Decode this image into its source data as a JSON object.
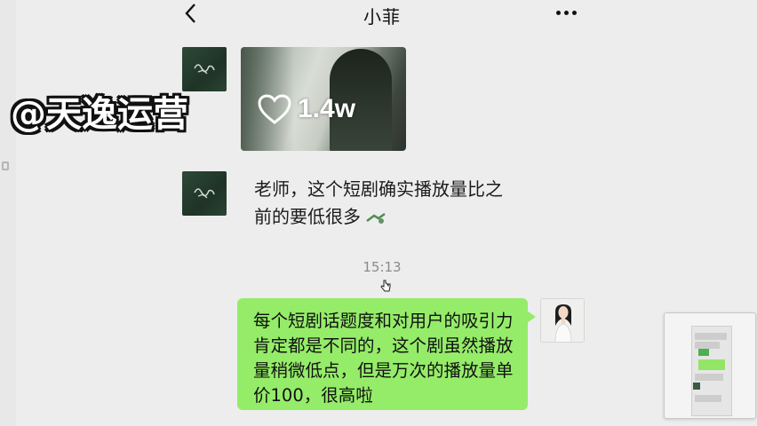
{
  "header": {
    "title": "小菲"
  },
  "watermark": "@天逸运营",
  "messages": {
    "shared_image": {
      "likes": "1.4w"
    },
    "incoming_text": "老师，这个短剧确实播放量比之前的要低很多",
    "timestamp": "15:13",
    "outgoing_text": "每个短剧话题度和对用户的吸引力肯定都是不同的，这个剧虽然播放量稍微低点，但是万次的播放量单价100，很高啦"
  },
  "colors": {
    "background": "#ededed",
    "outgoing_bubble": "#95ec69",
    "avatar_dark": "#2d4a37"
  },
  "icons": [
    "back-arrow-icon",
    "more-dots-icon",
    "heart-icon"
  ]
}
